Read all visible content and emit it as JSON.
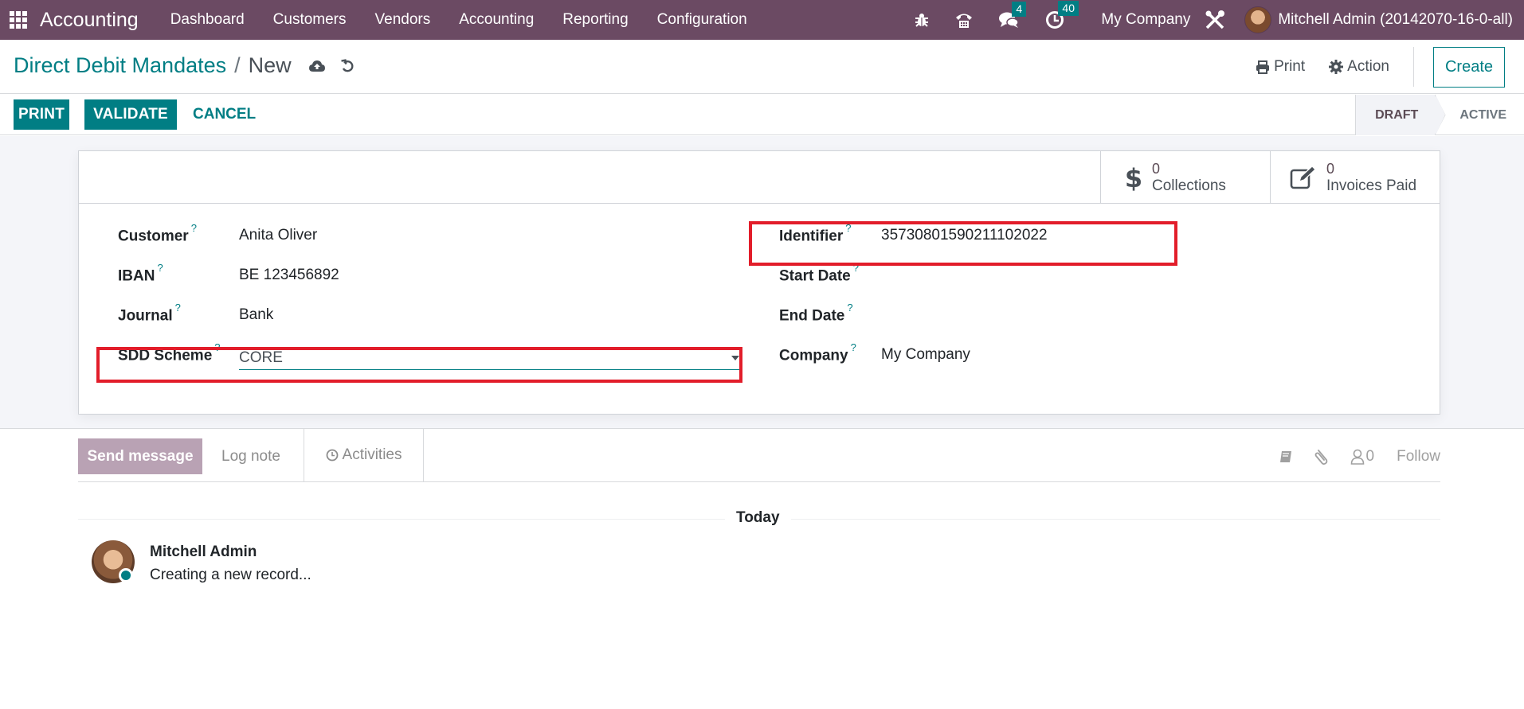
{
  "navbar": {
    "app_name": "Accounting",
    "menu": [
      "Dashboard",
      "Customers",
      "Vendors",
      "Accounting",
      "Reporting",
      "Configuration"
    ],
    "messages_badge": "4",
    "activities_badge": "40",
    "company": "My Company",
    "user": "Mitchell Admin (20142070-16-0-all)",
    "brand_color": "#6b4a63"
  },
  "breadcrumb": {
    "parent": "Direct Debit Mandates",
    "separator": "/",
    "current": "New"
  },
  "control_panel": {
    "print_label": "Print",
    "action_label": "Action",
    "create_label": "Create"
  },
  "header_buttons": {
    "print": "PRINT",
    "validate": "VALIDATE",
    "cancel": "CANCEL"
  },
  "statusbar": {
    "stages": [
      "DRAFT",
      "ACTIVE"
    ],
    "current": "DRAFT"
  },
  "stat_buttons": [
    {
      "icon": "dollar-icon",
      "value": "0",
      "label": "Collections"
    },
    {
      "icon": "edit-icon",
      "value": "0",
      "label": "Invoices Paid"
    }
  ],
  "form": {
    "left": [
      {
        "label": "Customer",
        "value": "Anita Oliver"
      },
      {
        "label": "IBAN",
        "value": "BE 123456892"
      },
      {
        "label": "Journal",
        "value": "Bank"
      },
      {
        "label": "SDD Scheme",
        "value": "CORE"
      }
    ],
    "right": [
      {
        "label": "Identifier",
        "value": "35730801590211102022"
      },
      {
        "label": "Start Date",
        "value": ""
      },
      {
        "label": "End Date",
        "value": ""
      },
      {
        "label": "Company",
        "value": "My Company"
      }
    ],
    "help_marker": "?"
  },
  "chatter": {
    "send_message": "Send message",
    "log_note": "Log note",
    "activities": "Activities",
    "followers_count": "0",
    "follow": "Follow",
    "date_separator": "Today",
    "messages": [
      {
        "author": "Mitchell Admin",
        "body": "Creating a new record..."
      }
    ]
  },
  "colors": {
    "primary": "#017e84",
    "highlight": "#e21d2a"
  }
}
